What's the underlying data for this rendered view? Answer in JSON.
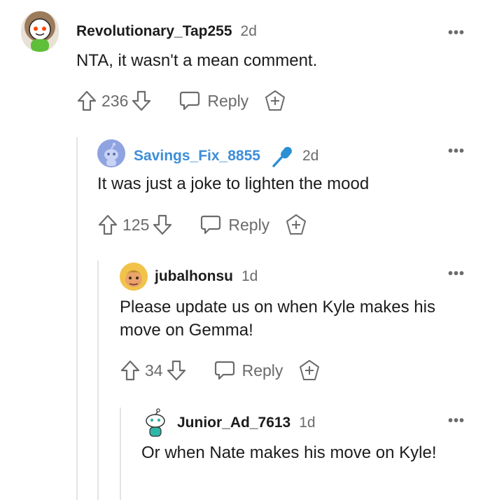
{
  "comments": [
    {
      "username": "Revolutionary_Tap255",
      "age": "2d",
      "text": "NTA, it wasn't a mean comment.",
      "votes": "236",
      "reply_label": "Reply",
      "avatar_icon": "snoo-green-shirt-avatar"
    },
    {
      "username": "Savings_Fix_8855",
      "op_badge_icon": "microphone-icon",
      "age": "2d",
      "text": "It was just a joke to lighten the mood",
      "votes": "125",
      "reply_label": "Reply",
      "avatar_icon": "default-snoo-avatar"
    },
    {
      "username": "jubalhonsu",
      "age": "1d",
      "text": "Please update us on when Kyle makes his move on Gemma!",
      "votes": "34",
      "reply_label": "Reply",
      "avatar_icon": "face-avatar"
    },
    {
      "username": "Junior_Ad_7613",
      "age": "1d",
      "text": "Or when Nate makes his move on Kyle!",
      "avatar_icon": "snoo-teal-avatar"
    }
  ],
  "colors": {
    "op_username": "#3d8ed8",
    "muted": "#6b6b6b",
    "thread_line": "#e4e4e4"
  },
  "more_label": "•••"
}
